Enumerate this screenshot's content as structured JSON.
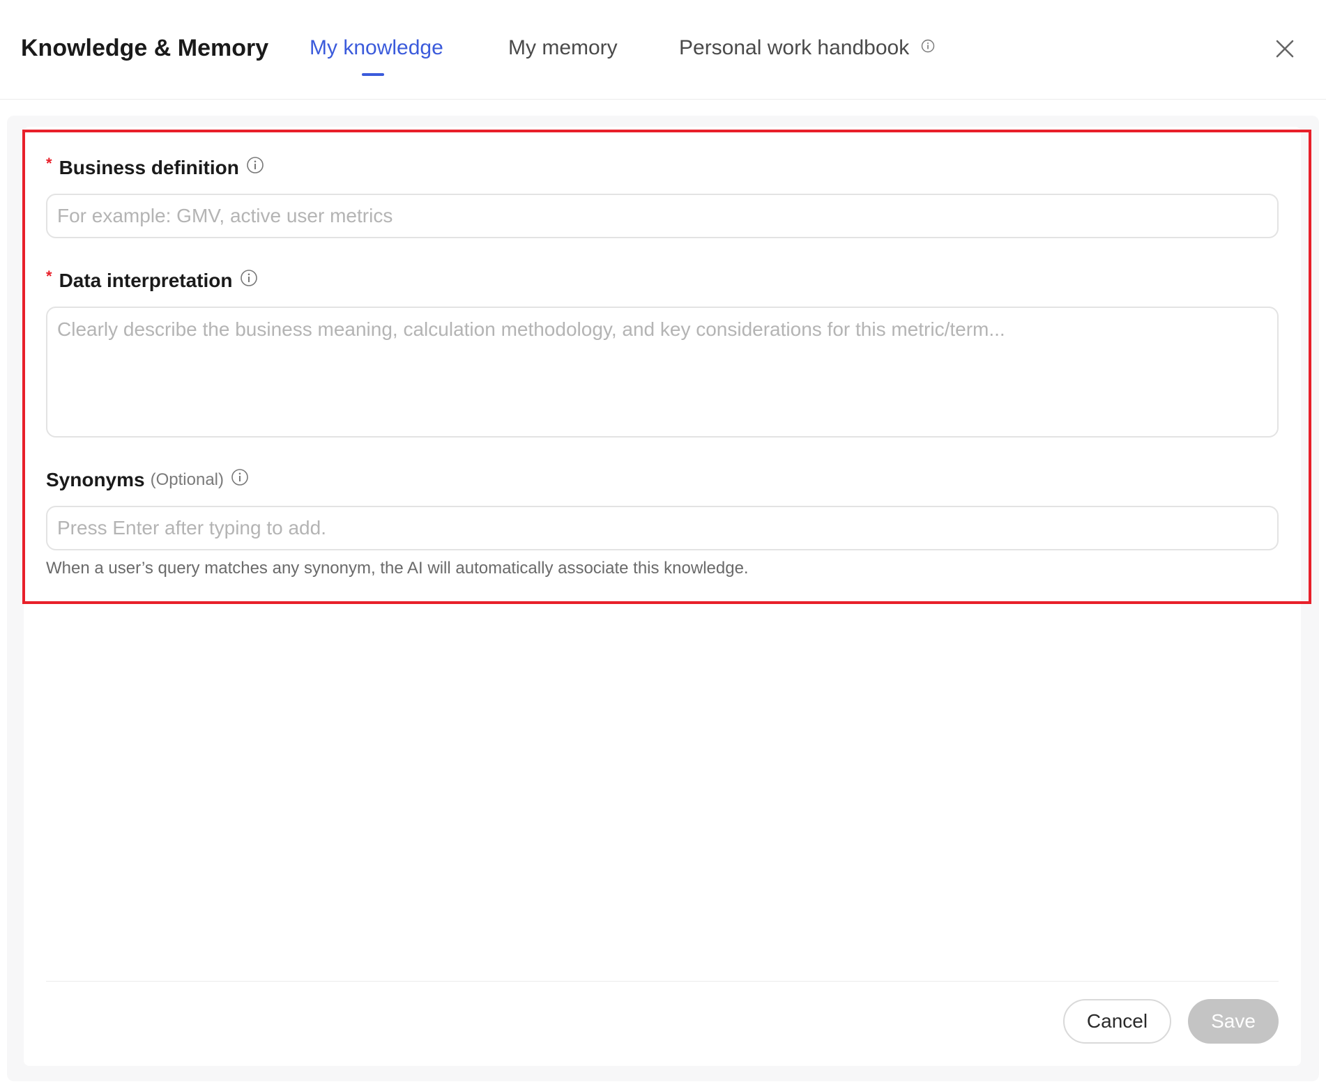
{
  "header": {
    "title": "Knowledge & Memory",
    "tabs": [
      {
        "label": "My knowledge",
        "active": true
      },
      {
        "label": "My memory",
        "active": false
      },
      {
        "label": "Personal work handbook",
        "active": false
      }
    ]
  },
  "form": {
    "business_definition": {
      "required_mark": "*",
      "label": "Business definition",
      "placeholder": "For example: GMV, active user metrics",
      "value": ""
    },
    "data_interpretation": {
      "required_mark": "*",
      "label": "Data interpretation",
      "placeholder": "Clearly describe the business meaning, calculation methodology, and key considerations for this metric/term...",
      "value": ""
    },
    "synonyms": {
      "label": "Synonyms",
      "optional_text": "(Optional)",
      "placeholder": "Press Enter after typing to add.",
      "value": "",
      "hint": "When a user’s query matches any synonym, the AI will automatically associate this knowledge."
    }
  },
  "footer": {
    "cancel_label": "Cancel",
    "save_label": "Save"
  },
  "colors": {
    "accent": "#3b5bdb",
    "required": "#e8202a",
    "highlight": "#e8202a",
    "disabled_button": "#c4c4c4"
  },
  "icons": {
    "info": "info-circle-icon",
    "close": "close-icon"
  }
}
